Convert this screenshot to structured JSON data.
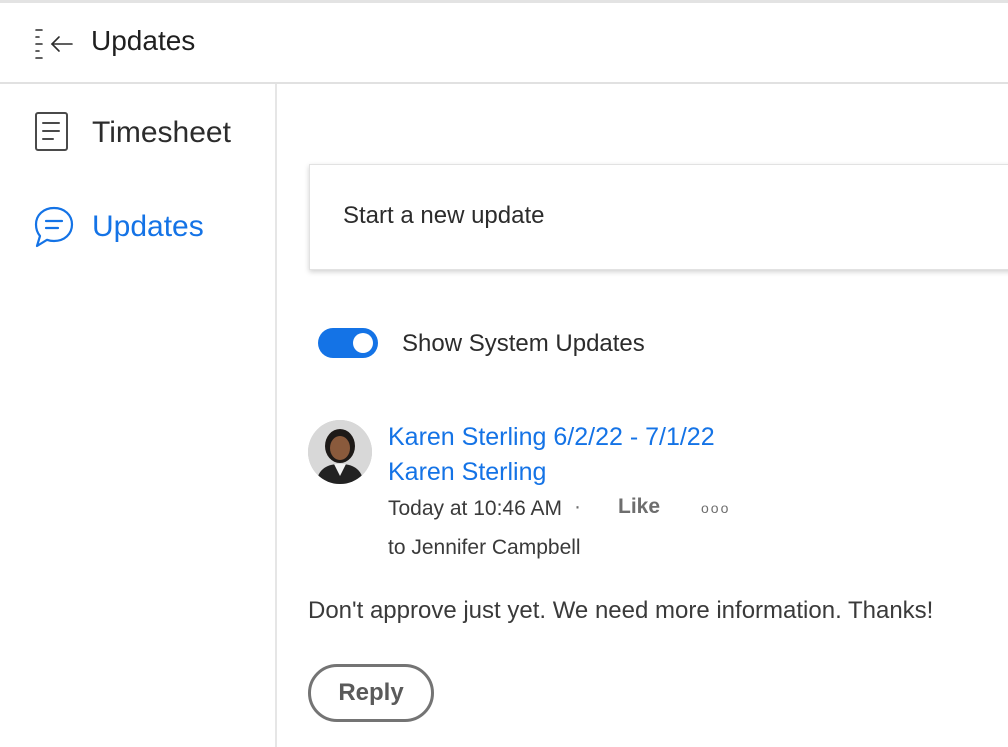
{
  "header": {
    "title": "Updates",
    "collapse_icon": "collapse-sidebar-icon"
  },
  "sidebar": {
    "items": [
      {
        "label": "Timesheet",
        "icon": "document-icon",
        "active": false
      },
      {
        "label": "Updates",
        "icon": "chat-bubble-icon",
        "active": true
      }
    ]
  },
  "main": {
    "new_update_placeholder": "Start a new update",
    "toggle": {
      "label": "Show System Updates",
      "on": true
    },
    "post": {
      "title": "Karen Sterling 6/2/22 - 7/1/22",
      "author": "Karen Sterling",
      "time": "Today at 10:46 AM",
      "separator": "·",
      "like_label": "Like",
      "more_label": "ooo",
      "recipient": "to Jennifer Campbell",
      "body": "Don't approve just yet. We need more information. Thanks!",
      "reply_label": "Reply"
    }
  },
  "colors": {
    "accent": "#1473e6",
    "text": "#2c2c2c",
    "muted": "#6e6e6e",
    "border": "#e1e1e1"
  }
}
